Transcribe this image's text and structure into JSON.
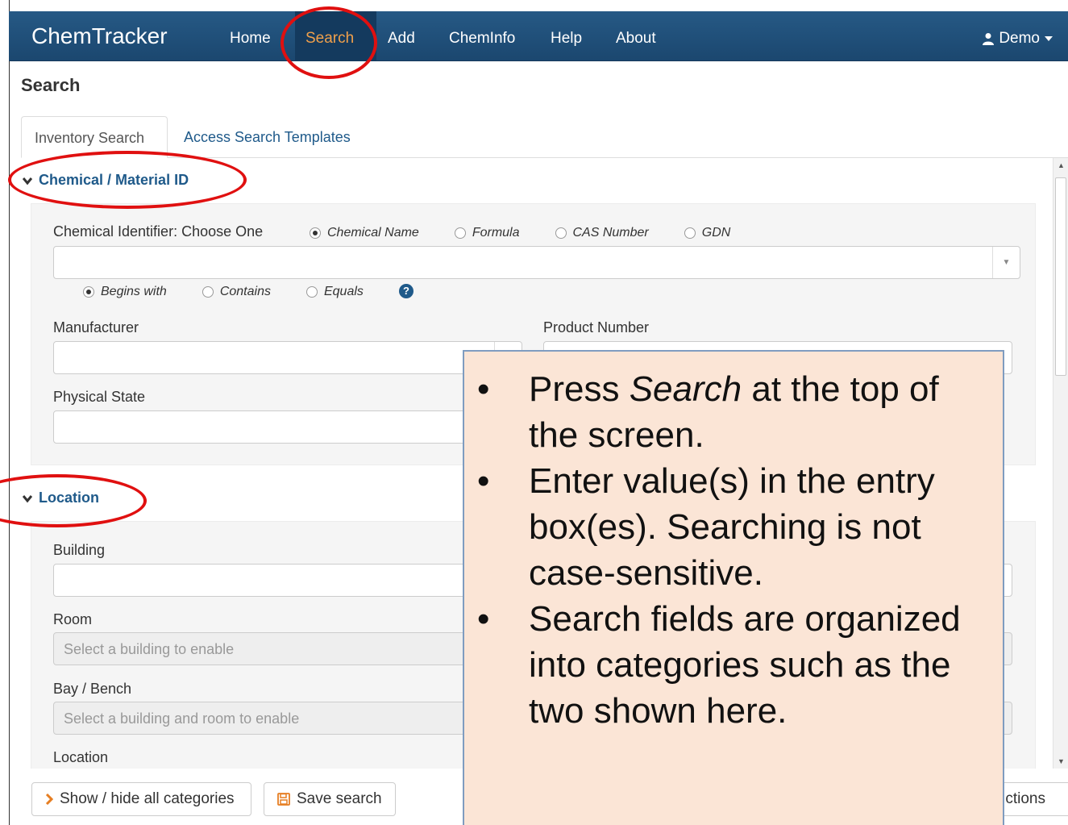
{
  "app": {
    "brand": "ChemTracker"
  },
  "nav": {
    "items": [
      {
        "label": "Home"
      },
      {
        "label": "Search"
      },
      {
        "label": "Add"
      },
      {
        "label": "ChemInfo"
      },
      {
        "label": "Help"
      },
      {
        "label": "About"
      }
    ],
    "active": "Search",
    "user": "Demo"
  },
  "page": {
    "title": "Search"
  },
  "tabs": [
    {
      "label": "Inventory Search",
      "active": true
    },
    {
      "label": "Access Search Templates",
      "active": false
    }
  ],
  "sections": {
    "chemical": {
      "title": "Chemical / Material ID",
      "identifier_label": "Chemical Identifier: Choose One",
      "identifier_options": [
        "Chemical Name",
        "Formula",
        "CAS Number",
        "GDN"
      ],
      "identifier_selected": "Chemical Name",
      "match_options": [
        "Begins with",
        "Contains",
        "Equals"
      ],
      "match_selected": "Begins with",
      "manufacturer_label": "Manufacturer",
      "product_number_label": "Product Number",
      "physical_state_label": "Physical State"
    },
    "location": {
      "title": "Location",
      "building_label": "Building",
      "room_label": "Room",
      "room_placeholder": "Select a building to enable",
      "bay_label": "Bay / Bench",
      "bay_placeholder": "Select a building and room to enable",
      "location_label": "Location"
    }
  },
  "footer": {
    "show_hide": "Show / hide all categories",
    "save_search": "Save search",
    "actions_partial": "ctions"
  },
  "callout": {
    "items": [
      [
        "Press ",
        "Search",
        " at the top of the screen."
      ],
      "Enter value(s) in the entry box(es). Searching is not case-sensitive.",
      "Search fields are organized into categories such as the two shown here."
    ]
  },
  "colors": {
    "navbar": "#1f4e79",
    "active_nav": "#f0a04b",
    "link": "#1f5a8a",
    "annotation": "#e01010",
    "callout_bg": "#fbe5d6"
  }
}
